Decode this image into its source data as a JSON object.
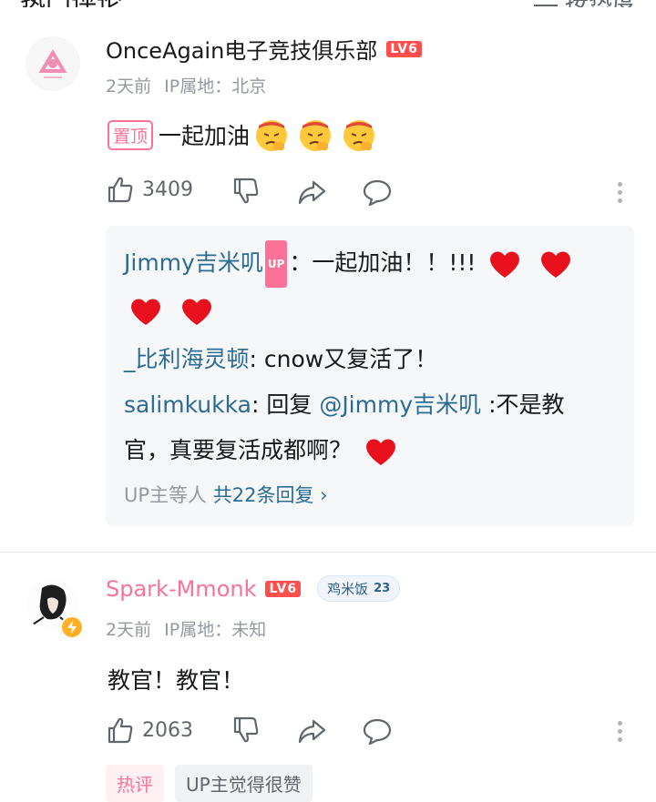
{
  "header": {
    "title": "热门评论",
    "sort_label": "按热度"
  },
  "comments": [
    {
      "username": "OnceAgain电子竞技俱乐部",
      "level": "LV6",
      "time": "2天前",
      "ip": "IP属地：北京",
      "pinned_label": "置顶",
      "text": "一起加油",
      "likes": "3409",
      "replies": [
        {
          "name": "Jimmy吉米叽",
          "badge": "UP",
          "text": "：一起加油！！!!!"
        },
        {
          "name": "_比利海灵顿",
          "text": ": cnow又复活了！"
        },
        {
          "name": "salimkukka",
          "text_a": ": 回复 ",
          "mention": "@Jimmy吉米叽",
          "text_b": " :不是教",
          "text_c": "官，真要复活成都啊？"
        }
      ],
      "reply_summary_prefix": "UP主等人",
      "reply_summary_total": "共22条回复"
    },
    {
      "username": "Spark-Mmonk",
      "level": "LV6",
      "medal_name": "鸡米饭",
      "medal_level": "23",
      "time": "2天前",
      "ip": "IP属地：未知",
      "text": "教官！教官！",
      "likes": "2063",
      "tags": [
        "热评",
        "UP主觉得很赞"
      ]
    }
  ],
  "colors": {
    "accent_pink": "#fb7299",
    "link_blue": "#2c6b92",
    "level_red": "#ff4e4e"
  }
}
